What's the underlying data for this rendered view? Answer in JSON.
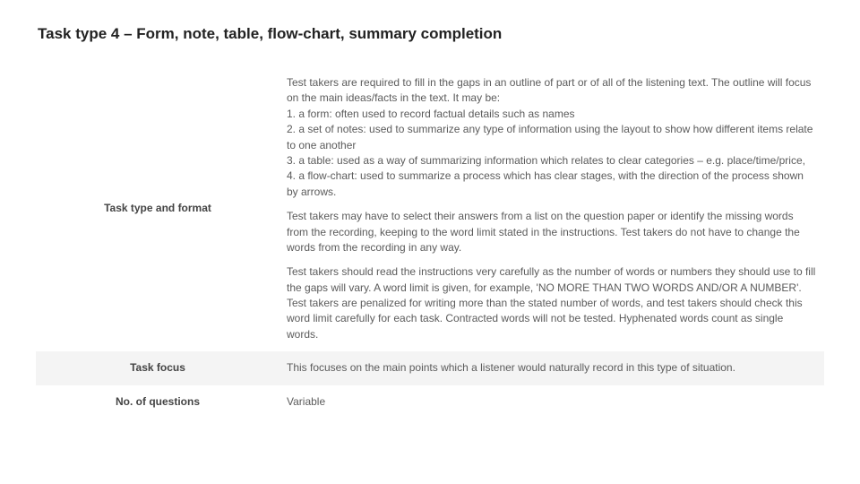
{
  "title": "Task type 4 – Form, note, table, flow-chart, summary completion",
  "rows": [
    {
      "label": "Task type and format",
      "body": [
        {
          "lines": [
            "Test takers are required to fill in the gaps in an outline of part or of all of the listening text. The outline will focus on the main ideas/facts in the text. It may be:",
            " 1. a form: often used to record factual details such as names",
            " 2. a set of notes: used to summarize any type of information using the layout to show how different items relate to one another",
            " 3. a table: used as a way of summarizing information which relates to clear categories – e.g. place/time/price,",
            " 4. a flow-chart: used to summarize a process which has clear stages, with the direction of the process shown by arrows."
          ]
        },
        {
          "lines": [
            "Test takers may have to select their answers from a list on the question paper or identify the missing words from the recording, keeping to the word limit stated in the instructions. Test takers do not have to change the words from the recording in any way."
          ]
        },
        {
          "lines": [
            "Test takers should read the instructions very carefully as the number of words or numbers they should use to fill the gaps will vary. A word limit is given, for example, 'NO MORE THAN TWO WORDS AND/OR A NUMBER'. Test takers are penalized for writing more than the stated number of words, and test takers should check this word limit carefully for each task. Contracted words will not be tested. Hyphenated words count as single words."
          ]
        }
      ]
    },
    {
      "label": "Task focus",
      "body": [
        {
          "lines": [
            "This focuses on the main points which a listener would naturally record in this type of situation."
          ]
        }
      ]
    },
    {
      "label": "No. of questions",
      "body": [
        {
          "lines": [
            "Variable"
          ]
        }
      ]
    }
  ]
}
